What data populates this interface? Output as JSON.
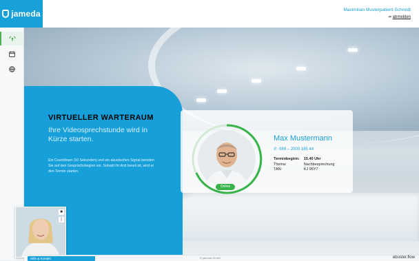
{
  "header": {
    "logo_text": "jameda",
    "user_name": "Maximilian Musterpatient-Schmidt",
    "logout_label": "abmelden"
  },
  "sidebar": {
    "items": [
      {
        "name": "video-icon"
      },
      {
        "name": "calendar-icon"
      },
      {
        "name": "globe-icon"
      }
    ]
  },
  "waiting_room": {
    "title": "VIRTUELLER WARTERAUM",
    "subtitle": "Ihre Videosprechstunde wird in Kürze starten.",
    "description": "Ein Countdown (10 Sekunden) und ein akustisches Signal bereiten Sie auf den Gesprächsbeginn vor. Sobald Ihr Arzt bereit ist, wird er den Termin starten."
  },
  "doctor": {
    "name": "Max Mustermann",
    "phone": "089 – 2000 185 44",
    "status": "Online",
    "info": [
      {
        "key": "Terminbeginn:",
        "value": "15.40 Uhr"
      },
      {
        "key": "Thema:",
        "value": "Nachbesprechung"
      },
      {
        "key": "TAN:",
        "value": "KJ 95Y7"
      }
    ]
  },
  "footer": {
    "button_label": "Hilfe & Kontakt",
    "center_text": "© jameda GmbH",
    "right_text": "ebuster.flow"
  },
  "colors": {
    "accent": "#18a0d8",
    "online": "#38b34a"
  }
}
